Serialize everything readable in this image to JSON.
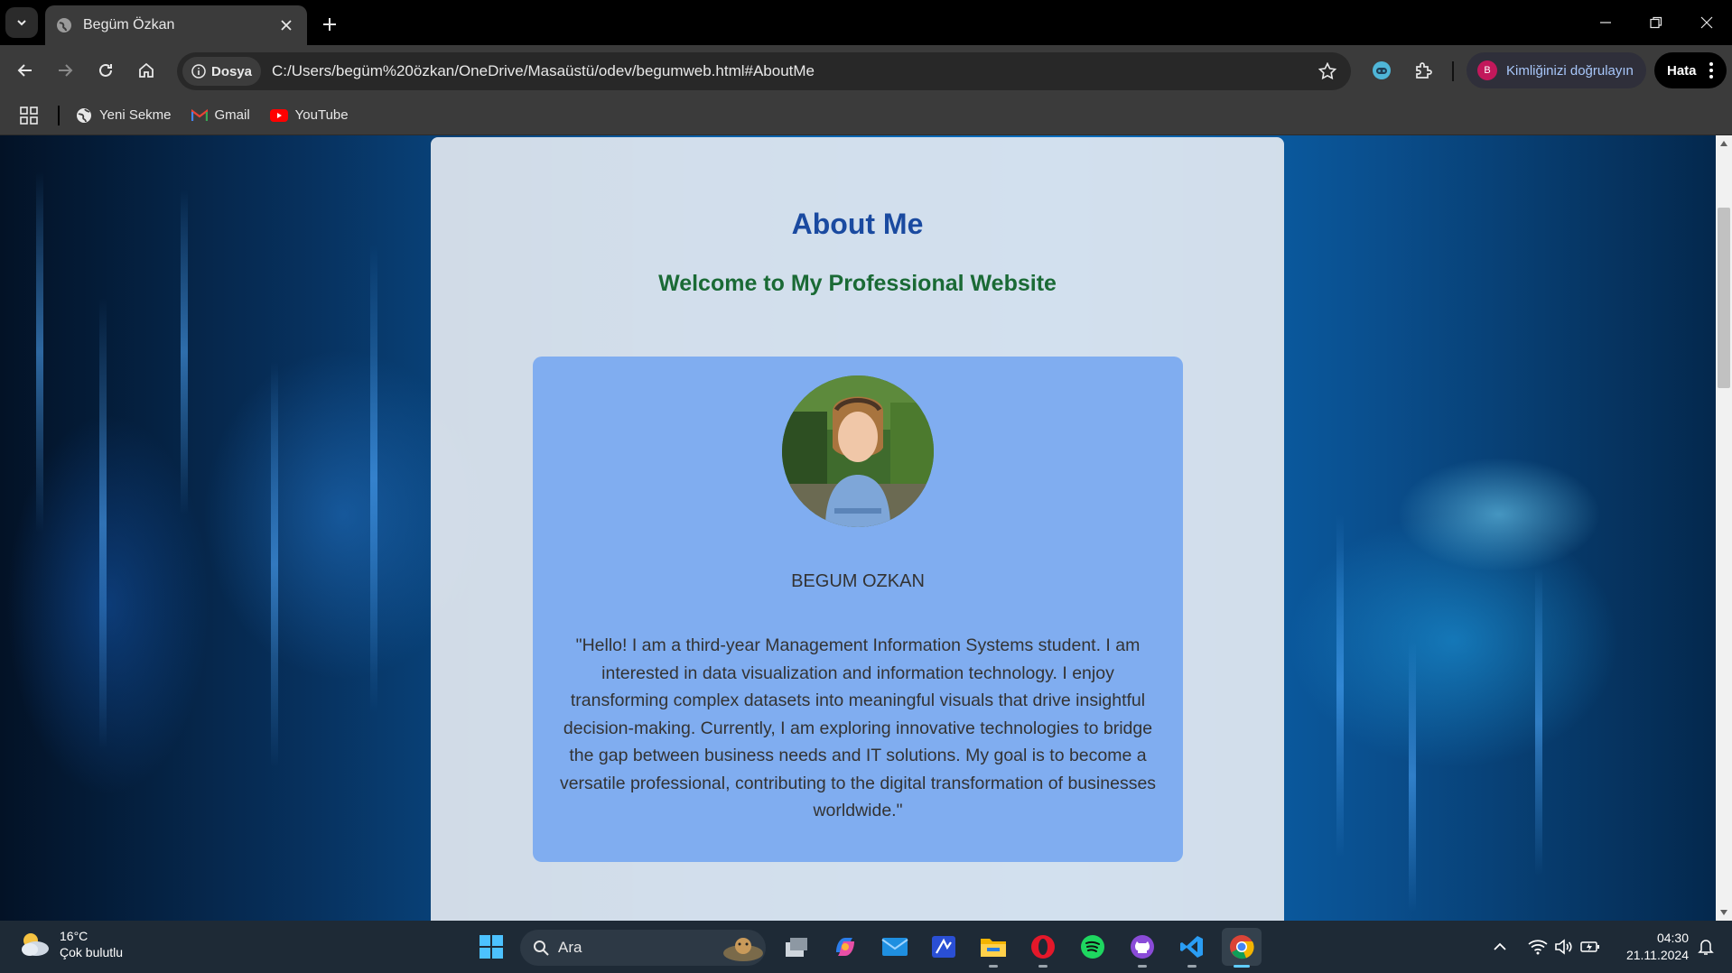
{
  "browser": {
    "tab_title": "Begüm Özkan",
    "url_chip": "Dosya",
    "url": "C:/Users/begüm%20özkan/OneDrive/Masaüstü/odev/begumweb.html#AboutMe",
    "profile_label": "Kimliğinizi doğrulayın",
    "profile_initial": "B",
    "error_label": "Hata"
  },
  "bookmarks": [
    {
      "label": "Yeni Sekme",
      "icon": "globe-icon"
    },
    {
      "label": "Gmail",
      "icon": "gmail-icon"
    },
    {
      "label": "YouTube",
      "icon": "youtube-icon"
    }
  ],
  "page": {
    "heading": "About Me",
    "subheading": "Welcome to My Professional Website",
    "name": "BEGUM OZKAN",
    "bio": "\"Hello! I am a third-year Management Information Systems student. I am interested in data visualization and information technology. I enjoy transforming complex datasets into meaningful visuals that drive insightful decision-making. Currently, I am exploring innovative technologies to bridge the gap between business needs and IT solutions. My goal is to become a versatile professional, contributing to the digital transformation of businesses worldwide.\""
  },
  "taskbar": {
    "weather_temp": "16°C",
    "weather_desc": "Çok bulutlu",
    "search_label": "Ara",
    "time": "04:30",
    "date": "21.11.2024"
  },
  "colors": {
    "heading": "#1a4aa0",
    "subheading": "#1a6a35",
    "profile_card": "#80adf0"
  }
}
